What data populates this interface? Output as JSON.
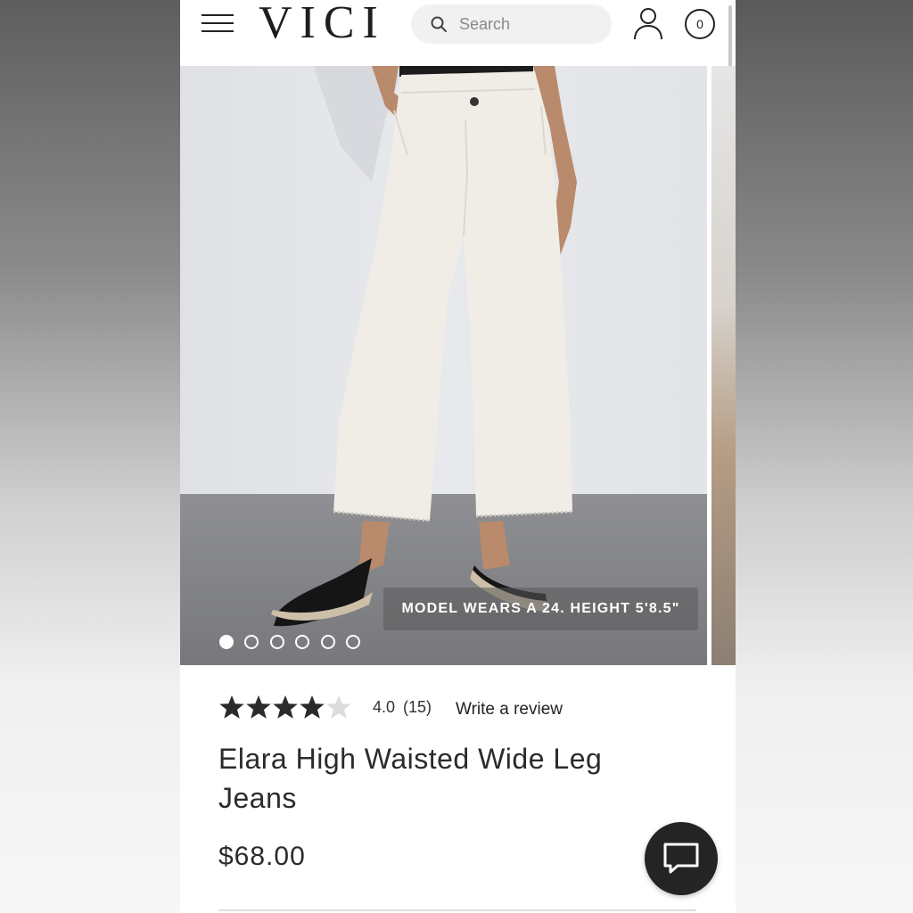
{
  "header": {
    "logo": "VICI",
    "search_placeholder": "Search",
    "cart_count": "0",
    "icons": [
      "menu-icon",
      "search-icon",
      "account-icon",
      "cart-icon"
    ]
  },
  "gallery": {
    "caption": "MODEL WEARS A 24. HEIGHT 5'8.5\"",
    "image_count": 6,
    "active_index": 0
  },
  "product": {
    "rating": {
      "value": "4.0",
      "count": "(15)",
      "stars_filled": 4,
      "stars_total": 5
    },
    "write_review": "Write a review",
    "title": "Elara High Waisted Wide Leg Jeans",
    "price": "$68.00"
  },
  "chat": {
    "icon": "chat-icon"
  },
  "colors": {
    "text": "#2b2b2b",
    "star_filled": "#2b2b2b",
    "star_empty": "#dcdcdc",
    "chat_bg": "#242424",
    "search_bg": "#f1f1f1"
  }
}
